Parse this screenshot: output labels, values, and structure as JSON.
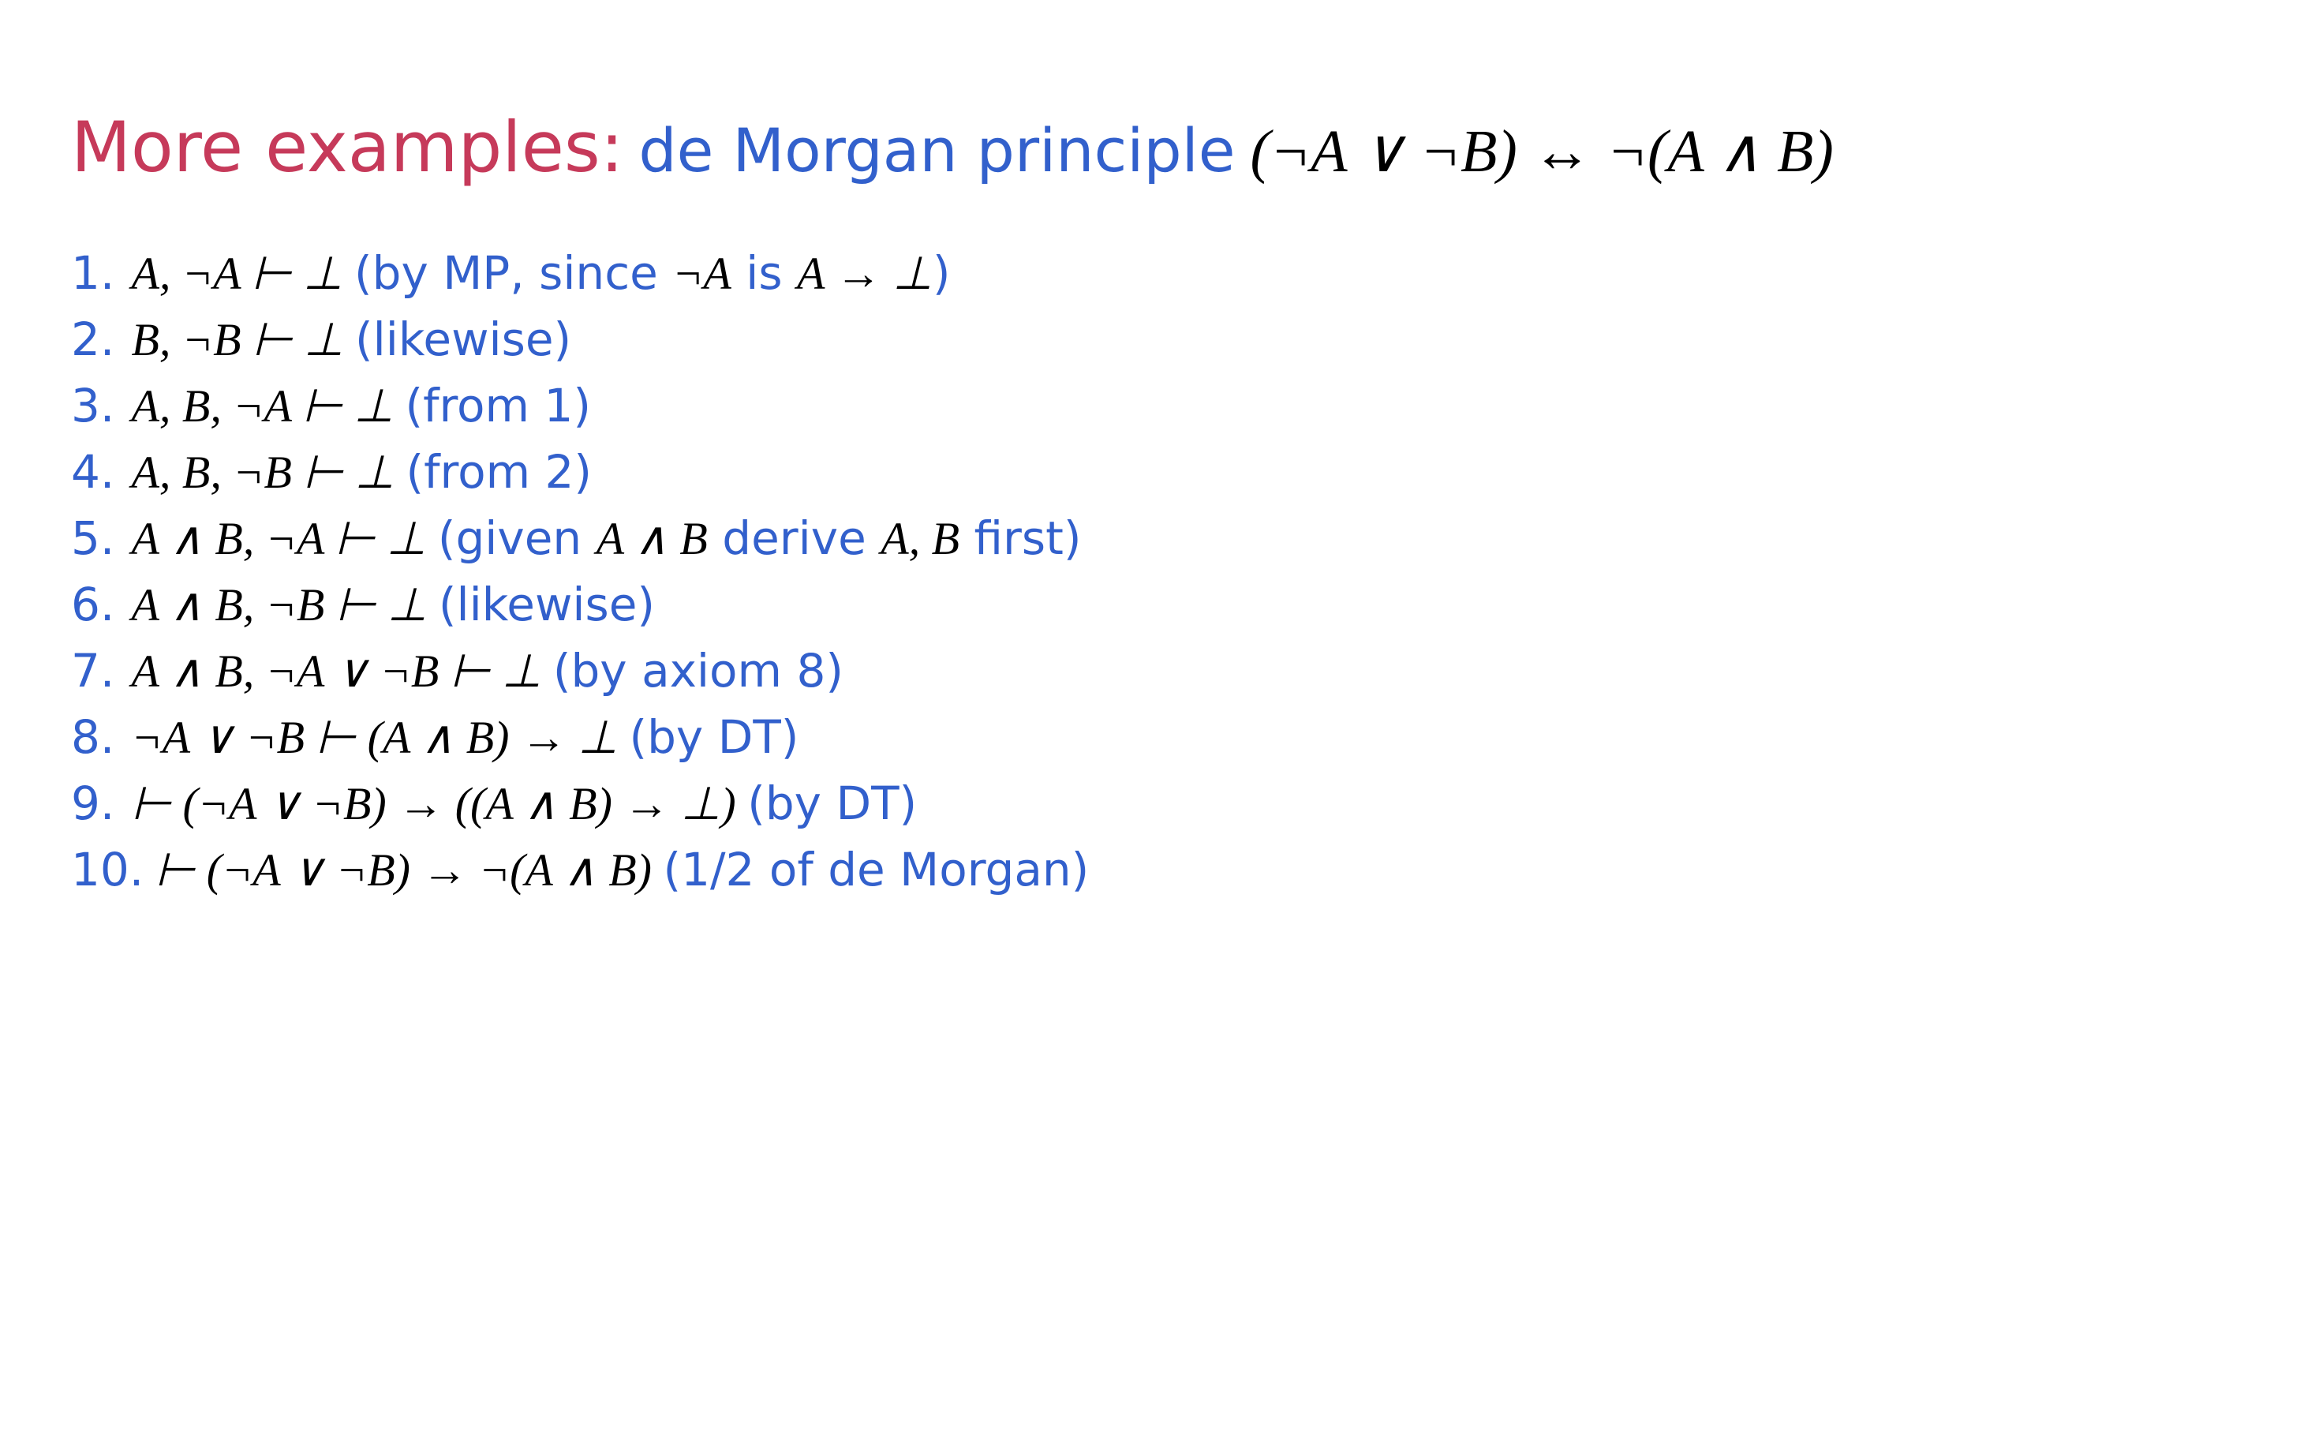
{
  "heading": {
    "lead": "More examples:",
    "subtitle": "de Morgan principle",
    "formula": "(¬A ∨ ¬B) ↔ ¬(A ∧ B)"
  },
  "lines": [
    {
      "num": "1.",
      "formula": "A, ¬A ⊢ ⊥",
      "reason_pre": "(by MP, since ",
      "reason_f1": "¬A",
      "reason_mid": " is ",
      "reason_f2": "A → ⊥",
      "reason_post": ")"
    },
    {
      "num": "2.",
      "formula": "B, ¬B ⊢ ⊥",
      "reason_pre": "(likewise)",
      "reason_f1": "",
      "reason_mid": "",
      "reason_f2": "",
      "reason_post": ""
    },
    {
      "num": "3.",
      "formula": "A, B, ¬A ⊢ ⊥",
      "reason_pre": "(from 1)",
      "reason_f1": "",
      "reason_mid": "",
      "reason_f2": "",
      "reason_post": ""
    },
    {
      "num": "4.",
      "formula": "A, B, ¬B ⊢ ⊥",
      "reason_pre": "(from 2)",
      "reason_f1": "",
      "reason_mid": "",
      "reason_f2": "",
      "reason_post": ""
    },
    {
      "num": "5.",
      "formula": "A ∧ B, ¬A ⊢ ⊥",
      "reason_pre": "(given ",
      "reason_f1": "A ∧ B",
      "reason_mid": " derive ",
      "reason_f2": "A, B",
      "reason_post": " first)"
    },
    {
      "num": "6.",
      "formula": "A ∧ B, ¬B ⊢ ⊥",
      "reason_pre": "(likewise)",
      "reason_f1": "",
      "reason_mid": "",
      "reason_f2": "",
      "reason_post": ""
    },
    {
      "num": "7.",
      "formula": "A ∧ B, ¬A ∨ ¬B ⊢ ⊥",
      "reason_pre": "(by axiom 8)",
      "reason_f1": "",
      "reason_mid": "",
      "reason_f2": "",
      "reason_post": ""
    },
    {
      "num": "8.",
      "formula": "¬A ∨ ¬B ⊢ (A ∧ B) → ⊥",
      "reason_pre": "(by DT)",
      "reason_f1": "",
      "reason_mid": "",
      "reason_f2": "",
      "reason_post": ""
    },
    {
      "num": "9.",
      "formula": "⊢ (¬A ∨ ¬B) → ((A ∧ B) → ⊥)",
      "reason_pre": "(by DT)",
      "reason_f1": "",
      "reason_mid": "",
      "reason_f2": "",
      "reason_post": ""
    },
    {
      "num": "10.",
      "formula": "⊢ (¬A ∨ ¬B) → ¬(A ∧ B)",
      "reason_pre": "(1/2 of de Morgan)",
      "reason_f1": "",
      "reason_mid": "",
      "reason_f2": "",
      "reason_post": ""
    }
  ]
}
